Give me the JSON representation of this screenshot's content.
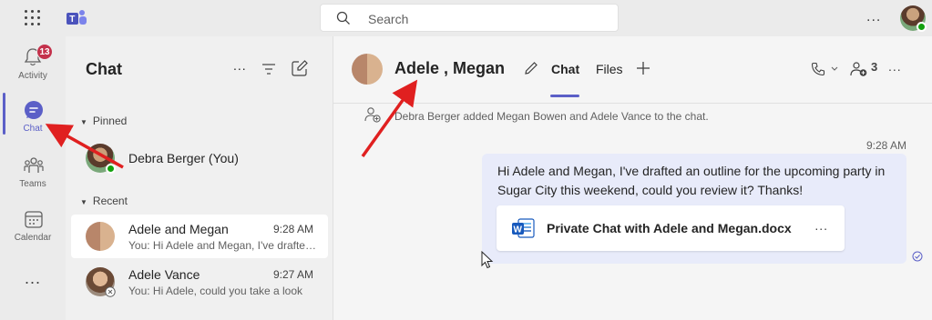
{
  "topbar": {
    "search_placeholder": "Search",
    "more_label": "...",
    "app_icon": "teams-logo-icon"
  },
  "rail": {
    "items": [
      {
        "label": "Activity",
        "icon": "bell-icon",
        "badge": "13"
      },
      {
        "label": "Chat",
        "icon": "chat-icon",
        "active": true
      },
      {
        "label": "Teams",
        "icon": "teams-icon"
      },
      {
        "label": "Calendar",
        "icon": "calendar-icon"
      }
    ],
    "more_label": "..."
  },
  "chat_list": {
    "title": "Chat",
    "more_label": "...",
    "sections": {
      "pinned": "Pinned",
      "recent": "Recent"
    },
    "pinned": [
      {
        "name": "Debra Berger (You)"
      }
    ],
    "recent": [
      {
        "name": "Adele and Megan",
        "time": "9:28 AM",
        "preview": "You: Hi Adele and Megan, I've drafted an outline"
      },
      {
        "name": "Adele Vance",
        "time": "9:27 AM",
        "preview": "You: Hi Adele, could you take a look"
      }
    ]
  },
  "conversation": {
    "title": "Adele , Megan",
    "tabs": [
      "Chat",
      "Files"
    ],
    "participants_count": "3",
    "header_more": "...",
    "system_message": "Debra Berger added Megan Bowen and Adele Vance to the chat.",
    "message": {
      "time": "9:28 AM",
      "text": "Hi Adele and Megan, I've drafted an outline for the upcoming party in Sugar City this weekend, could you review it? Thanks!",
      "attachment": "Private Chat with Adele and Megan.docx",
      "attachment_more": "..."
    }
  },
  "colors": {
    "accent": "#5b5fc7",
    "badge": "#c4314b",
    "presence": "#13a10e",
    "bubble": "#e8ebfa",
    "annotation_arrow": "#e02020"
  }
}
